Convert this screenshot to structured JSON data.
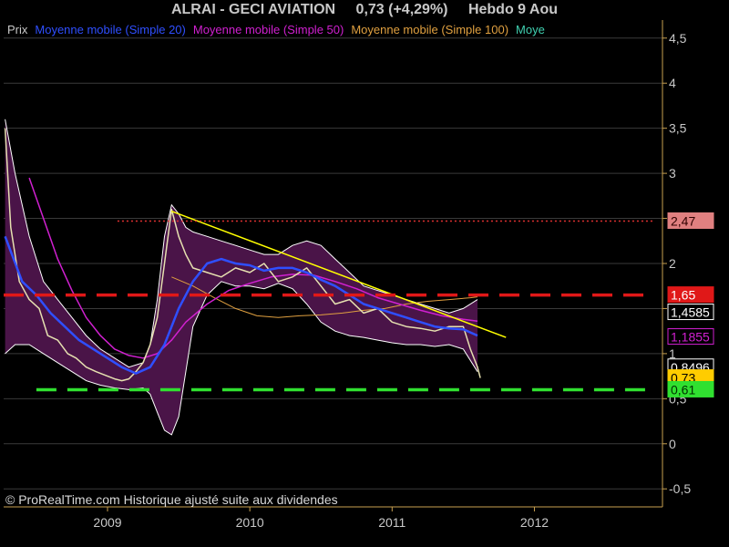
{
  "header": {
    "name": "ALRAI - GECI AVIATION",
    "change": "0,73 (+4,29%)",
    "period": "Hebdo  9 Aou"
  },
  "legend": [
    {
      "label": "Prix",
      "color": "#c8c8c8"
    },
    {
      "label": "Moyenne mobile (Simple 20)",
      "color": "#2f4fff"
    },
    {
      "label": "Moyenne mobile (Simple 50)",
      "color": "#d020d0"
    },
    {
      "label": "Moyenne mobile (Simple 100)",
      "color": "#e0a040"
    },
    {
      "label": "Moye",
      "color": "#40d0b0"
    }
  ],
  "footer": {
    "copyright": "© ProRealTime.com Historique ajusté suite aux dividendes"
  },
  "colors": {
    "background": "#000000",
    "price": "#e6e0b0",
    "band_fill": "#4a1448",
    "band_edge": "#ffffff",
    "ma20": "#2f4fff",
    "ma50": "#d020d0",
    "ma100": "#e0a040",
    "trend": "#ffff00",
    "resistance": "#e01818",
    "support": "#30e030",
    "top_dotted": "#e03030",
    "axis": "#c8a050"
  },
  "chart_data": {
    "type": "line",
    "ylim": [
      -0.7,
      4.7
    ],
    "xlim": [
      2008.27,
      2012.9
    ],
    "y_ticks": [
      "-0,5",
      "0",
      "0,5",
      "1",
      "1,5",
      "2",
      "2,5",
      "3",
      "3,5",
      "4",
      "4,5"
    ],
    "y_tick_values": [
      -0.5,
      0,
      0.5,
      1,
      1.5,
      2,
      2.5,
      3,
      3.5,
      4,
      4.5
    ],
    "x_ticks": [
      {
        "value": 2009.0,
        "label": "2009"
      },
      {
        "value": 2010.0,
        "label": "2010"
      },
      {
        "value": 2011.0,
        "label": "2011"
      },
      {
        "value": 2012.0,
        "label": "2012"
      }
    ],
    "series": [
      {
        "name": "Prix",
        "role": "price",
        "x": [
          2008.28,
          2008.32,
          2008.38,
          2008.45,
          2008.52,
          2008.58,
          2008.65,
          2008.72,
          2008.78,
          2008.85,
          2008.92,
          2009.0,
          2009.05,
          2009.1,
          2009.15,
          2009.2,
          2009.25,
          2009.3,
          2009.35,
          2009.4,
          2009.45,
          2009.5,
          2009.55,
          2009.6,
          2009.7,
          2009.8,
          2009.9,
          2010.0,
          2010.1,
          2010.2,
          2010.3,
          2010.4,
          2010.5,
          2010.6,
          2010.7,
          2010.8,
          2010.9,
          2011.0,
          2011.1,
          2011.2,
          2011.3,
          2011.4,
          2011.5,
          2011.55,
          2011.6,
          2011.62
        ],
        "y": [
          3.5,
          2.4,
          1.8,
          1.6,
          1.5,
          1.2,
          1.15,
          1.0,
          0.95,
          0.85,
          0.8,
          0.75,
          0.72,
          0.7,
          0.72,
          0.8,
          0.9,
          1.1,
          1.4,
          2.0,
          2.6,
          2.3,
          2.1,
          1.95,
          1.9,
          1.85,
          1.95,
          1.9,
          2.0,
          1.8,
          1.85,
          1.95,
          1.75,
          1.55,
          1.6,
          1.45,
          1.5,
          1.35,
          1.3,
          1.28,
          1.25,
          1.3,
          1.3,
          1.05,
          0.85,
          0.73
        ]
      },
      {
        "name": "Moyenne mobile (Simple 20)",
        "role": "ma20",
        "x": [
          2008.28,
          2008.4,
          2008.5,
          2008.6,
          2008.7,
          2008.8,
          2008.9,
          2009.0,
          2009.1,
          2009.2,
          2009.3,
          2009.4,
          2009.5,
          2009.6,
          2009.7,
          2009.8,
          2009.9,
          2010.0,
          2010.1,
          2010.2,
          2010.3,
          2010.4,
          2010.5,
          2010.6,
          2010.7,
          2010.8,
          2010.9,
          2011.0,
          2011.1,
          2011.2,
          2011.3,
          2011.4,
          2011.5,
          2011.6
        ],
        "y": [
          2.3,
          1.8,
          1.65,
          1.45,
          1.3,
          1.15,
          1.05,
          0.95,
          0.85,
          0.78,
          0.85,
          1.1,
          1.5,
          1.8,
          2.0,
          2.05,
          2.0,
          1.98,
          1.92,
          1.95,
          1.95,
          1.9,
          1.82,
          1.75,
          1.65,
          1.55,
          1.5,
          1.45,
          1.4,
          1.35,
          1.3,
          1.28,
          1.27,
          1.2
        ]
      },
      {
        "name": "Moyenne mobile (Simple 50)",
        "role": "ma50",
        "x": [
          2008.45,
          2008.55,
          2008.65,
          2008.75,
          2008.85,
          2008.95,
          2009.05,
          2009.15,
          2009.25,
          2009.35,
          2009.45,
          2009.55,
          2009.7,
          2009.85,
          2010.0,
          2010.15,
          2010.3,
          2010.45,
          2010.6,
          2010.75,
          2010.9,
          2011.05,
          2011.2,
          2011.35,
          2011.5,
          2011.6
        ],
        "y": [
          2.95,
          2.5,
          2.05,
          1.7,
          1.4,
          1.2,
          1.05,
          0.98,
          0.95,
          1.0,
          1.15,
          1.35,
          1.55,
          1.7,
          1.78,
          1.85,
          1.88,
          1.87,
          1.8,
          1.72,
          1.62,
          1.55,
          1.48,
          1.42,
          1.38,
          1.36
        ]
      },
      {
        "name": "Moyenne mobile (Simple 100)",
        "role": "ma100",
        "x": [
          2009.45,
          2009.6,
          2009.75,
          2009.9,
          2010.05,
          2010.2,
          2010.35,
          2010.5,
          2010.65,
          2010.8,
          2010.95,
          2011.1,
          2011.25,
          2011.4,
          2011.55,
          2011.6
        ],
        "y": [
          1.85,
          1.75,
          1.62,
          1.5,
          1.42,
          1.4,
          1.42,
          1.43,
          1.45,
          1.48,
          1.5,
          1.55,
          1.58,
          1.6,
          1.62,
          1.63
        ]
      }
    ],
    "bands": {
      "x": [
        2008.28,
        2008.35,
        2008.45,
        2008.55,
        2008.65,
        2008.75,
        2008.85,
        2008.95,
        2009.05,
        2009.15,
        2009.25,
        2009.3,
        2009.35,
        2009.4,
        2009.45,
        2009.5,
        2009.55,
        2009.6,
        2009.7,
        2009.8,
        2009.9,
        2010.0,
        2010.1,
        2010.2,
        2010.3,
        2010.4,
        2010.5,
        2010.6,
        2010.7,
        2010.8,
        2010.9,
        2011.0,
        2011.1,
        2011.2,
        2011.3,
        2011.4,
        2011.5,
        2011.6
      ],
      "upper": [
        3.6,
        3.0,
        2.3,
        1.8,
        1.6,
        1.4,
        1.2,
        1.05,
        0.95,
        0.85,
        0.9,
        1.1,
        1.6,
        2.3,
        2.65,
        2.55,
        2.4,
        2.35,
        2.3,
        2.25,
        2.2,
        2.15,
        2.1,
        2.1,
        2.2,
        2.25,
        2.2,
        2.05,
        1.9,
        1.75,
        1.7,
        1.65,
        1.6,
        1.55,
        1.5,
        1.45,
        1.5,
        1.6
      ],
      "lower": [
        1.0,
        1.1,
        1.1,
        1.0,
        0.9,
        0.8,
        0.7,
        0.65,
        0.62,
        0.6,
        0.62,
        0.55,
        0.35,
        0.15,
        0.1,
        0.3,
        0.8,
        1.3,
        1.65,
        1.8,
        1.75,
        1.75,
        1.72,
        1.78,
        1.72,
        1.55,
        1.35,
        1.25,
        1.2,
        1.18,
        1.15,
        1.12,
        1.1,
        1.1,
        1.08,
        1.1,
        1.05,
        0.8
      ]
    },
    "trendline": {
      "x": [
        2009.45,
        2011.8
      ],
      "y": [
        2.58,
        1.18
      ]
    },
    "levels": [
      {
        "value": 2.47,
        "label": "2,47",
        "style": "dotted",
        "color": "#e03030",
        "box": "#e08080",
        "text_color": "#300000",
        "x_start": 2009.07
      },
      {
        "value": 1.65,
        "label": "1,65",
        "style": "dashed",
        "color": "#e01818",
        "box": "#e01818",
        "text_color": "#ffffff",
        "x_start": 2008.27
      },
      {
        "value": 0.6,
        "label": "0,61",
        "style": "dashed",
        "color": "#30e030",
        "box": "#30e030",
        "text_color": "#003000",
        "x_start": 2008.5
      }
    ],
    "value_tags": [
      {
        "value": 1.4585,
        "label": "1,4585",
        "box": "#000000",
        "text_color": "#ffffff",
        "border": "#ffffff"
      },
      {
        "value": 1.1855,
        "label": "1,1855",
        "box": "#000000",
        "text_color": "#d020d0",
        "border": "#d020d0"
      },
      {
        "value": 0.8496,
        "label": "0,8496",
        "box": "#000000",
        "text_color": "#ffffff",
        "border": "#ffffff"
      },
      {
        "value": 0.73,
        "label": "0,73",
        "box": "#ffcc00",
        "text_color": "#000000",
        "border": "#ffcc00"
      }
    ]
  }
}
